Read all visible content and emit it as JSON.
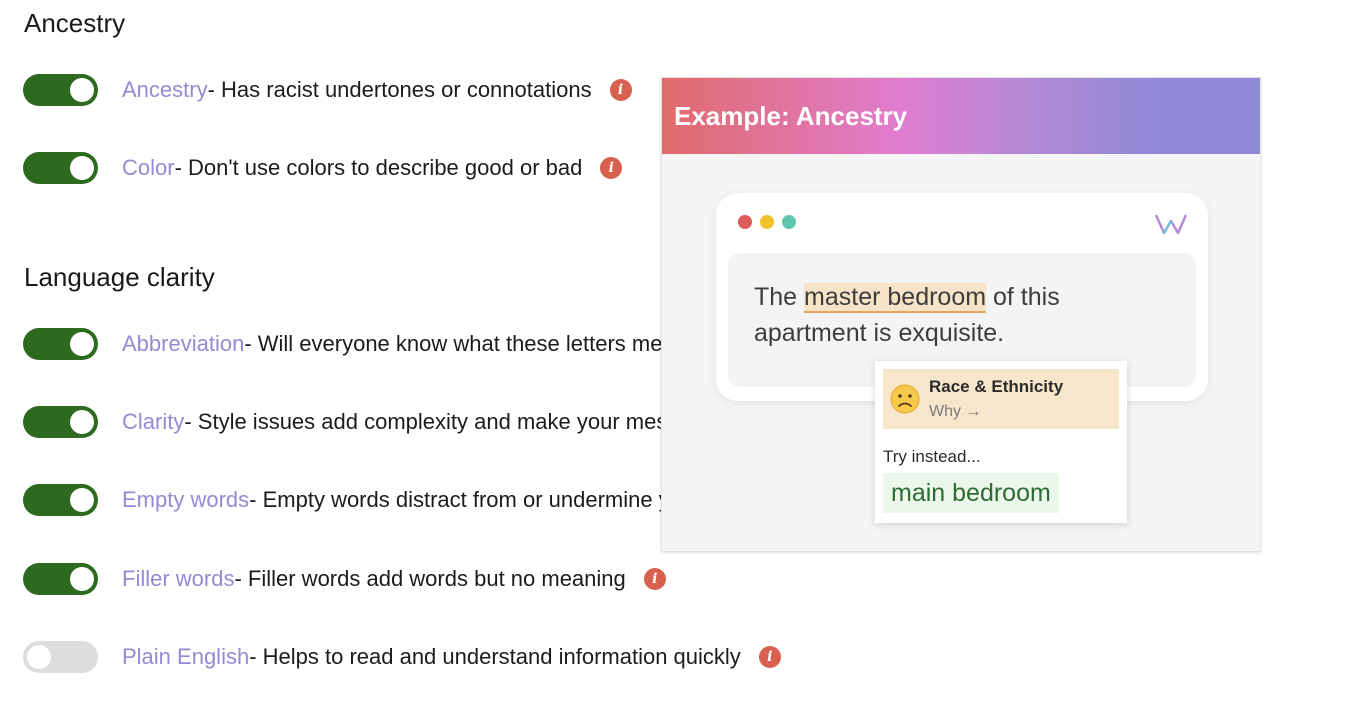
{
  "sections": {
    "ancestry": {
      "title": "Ancestry"
    },
    "language_clarity": {
      "title": "Language clarity"
    }
  },
  "rules": [
    {
      "name": "Ancestry",
      "desc": " - Has racist undertones or connotations",
      "enabled": true
    },
    {
      "name": "Color",
      "desc": " - Don't use colors to describe good or bad",
      "enabled": true
    },
    {
      "name": "Abbreviation",
      "desc": " - Will everyone know what these letters mean?",
      "enabled": true
    },
    {
      "name": "Clarity",
      "desc": " - Style issues add complexity and make your message unclear",
      "enabled": true
    },
    {
      "name": "Empty words",
      "desc": " - Empty words distract from or undermine your message",
      "enabled": true
    },
    {
      "name": "Filler words",
      "desc": " - Filler words add words but no meaning",
      "enabled": true
    },
    {
      "name": "Plain English",
      "desc": " - Helps to read and understand information quickly",
      "enabled": false
    }
  ],
  "info_icon": {
    "icon": "info-icon",
    "glyph": "i",
    "color": "#d8604f"
  },
  "example": {
    "title": "Example: Ancestry",
    "sentence_before": "The ",
    "sentence_highlight": "master bedroom",
    "sentence_after": " of this apartment is exquisite.",
    "card": {
      "category": "Race & Ethnicity",
      "why": "Why →",
      "try_label": "Try instead...",
      "suggestion": "main bedroom"
    }
  },
  "colors": {
    "toggle_on": "#2d6a1f",
    "toggle_off": "#dddddd",
    "rule_name": "#958ad4",
    "highlight": "#f7e3c8",
    "suggestion_bg": "#ebf7ea"
  }
}
